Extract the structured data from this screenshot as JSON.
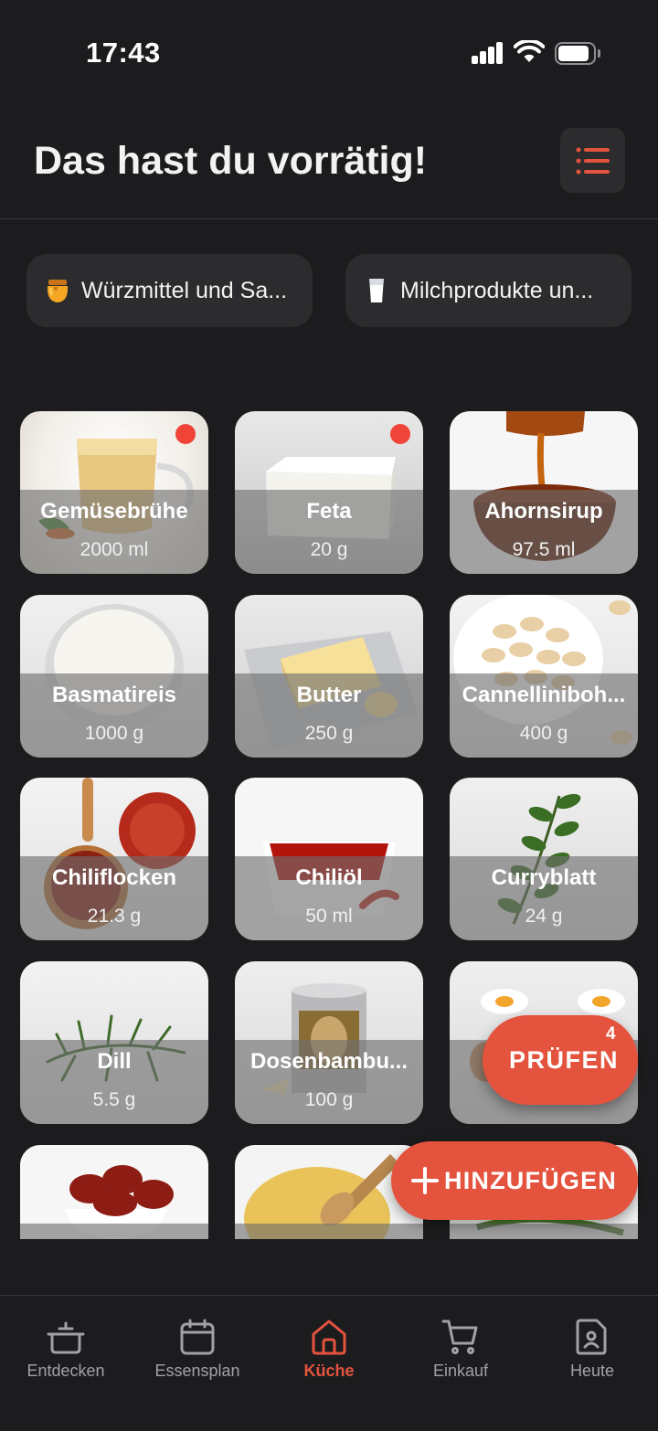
{
  "status_bar": {
    "time": "17:43"
  },
  "header": {
    "title": "Das hast du vorrätig!"
  },
  "categories": [
    {
      "label": "Würzmittel und Sa...",
      "icon": "honey-pot-icon"
    },
    {
      "label": "Milchprodukte un...",
      "icon": "milk-glass-icon"
    }
  ],
  "pantry_items": [
    {
      "name": "Gemüsebrühe",
      "quantity": "2000 ml",
      "alert": true
    },
    {
      "name": "Feta",
      "quantity": "20 g",
      "alert": true
    },
    {
      "name": "Ahornsirup",
      "quantity": "97.5 ml",
      "alert": false
    },
    {
      "name": "Basmatireis",
      "quantity": "1000 g",
      "alert": false
    },
    {
      "name": "Butter",
      "quantity": "250 g",
      "alert": false
    },
    {
      "name": "Cannelliniboh...",
      "quantity": "400 g",
      "alert": false
    },
    {
      "name": "Chiliflocken",
      "quantity": "21.3 g",
      "alert": false
    },
    {
      "name": "Chiliöl",
      "quantity": "50 ml",
      "alert": false
    },
    {
      "name": "Curryblatt",
      "quantity": "24 g",
      "alert": false
    },
    {
      "name": "Dill",
      "quantity": "5.5 g",
      "alert": false
    },
    {
      "name": "Dosenbambu...",
      "quantity": "100 g",
      "alert": false
    },
    {
      "name": "",
      "quantity": "",
      "alert": false
    },
    {
      "name": "",
      "quantity": "",
      "alert": false
    },
    {
      "name": "",
      "quantity": "",
      "alert": false
    },
    {
      "name": "",
      "quantity": "",
      "alert": false
    }
  ],
  "actions": {
    "check_label": "PRÜFEN",
    "check_count": "4",
    "add_label": "HINZUFÜGEN"
  },
  "tabs": [
    {
      "label": "Entdecken",
      "icon": "cooking-pot-icon",
      "active": false
    },
    {
      "label": "Essensplan",
      "icon": "calendar-icon",
      "active": false
    },
    {
      "label": "Küche",
      "icon": "home-icon",
      "active": true
    },
    {
      "label": "Einkauf",
      "icon": "shopping-cart-icon",
      "active": false
    },
    {
      "label": "Heute",
      "icon": "profile-document-icon",
      "active": false
    }
  ],
  "colors": {
    "background": "#1c1c1e",
    "surface": "#2c2c2e",
    "accent": "#e4533d",
    "alert_dot": "#f04438",
    "tab_inactive": "#a1a1a6"
  }
}
